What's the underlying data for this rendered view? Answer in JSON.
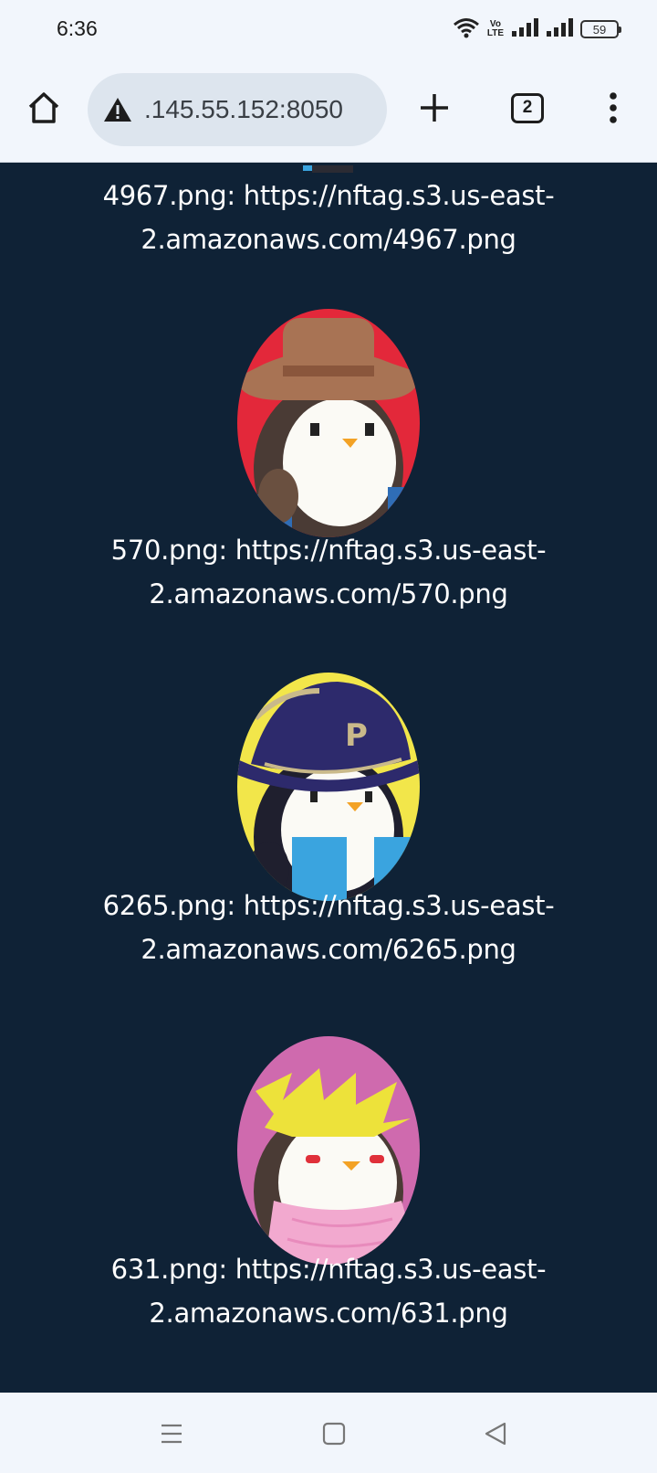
{
  "status_bar": {
    "time": "6:36",
    "battery": "59",
    "volte_top": "Vo",
    "volte_bottom": "LTE"
  },
  "toolbar": {
    "url": ".145.55.152:8050",
    "tab_count": "2"
  },
  "items": [
    {
      "caption": "4967.png: https://nftag.s3.us-east-2.amazonaws.com/4967.png"
    },
    {
      "caption": "570.png: https://nftag.s3.us-east-2.amazonaws.com/570.png",
      "bg": "#e3283a",
      "accent": "#2f6db6",
      "hat": "#a87354"
    },
    {
      "caption": "6265.png: https://nftag.s3.us-east-2.amazonaws.com/6265.png",
      "bg": "#f2e64a",
      "accent": "#3aa4df",
      "hat": "#2d2a6c"
    },
    {
      "caption": "631.png: https://nftag.s3.us-east-2.amazonaws.com/631.png",
      "bg": "#cf6aae",
      "accent": "#f2a9cf",
      "hat": "#ede23a"
    }
  ],
  "colors": {
    "page_background": "#0f2236",
    "caption_text": "#ffffff"
  }
}
